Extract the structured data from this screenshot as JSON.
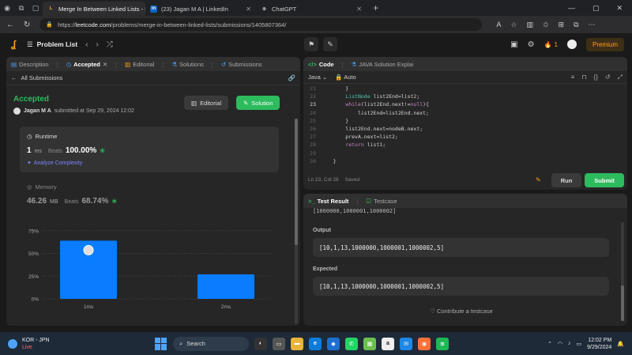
{
  "browser": {
    "tabs": [
      {
        "title": "Merge In Between Linked Lists - L",
        "active": true,
        "fav": "L",
        "favColor": "#ffa116"
      },
      {
        "title": "(23) Jagan M A | LinkedIn",
        "active": false,
        "fav": "in",
        "favColor": "#0a66c2"
      },
      {
        "title": "ChatGPT",
        "active": false,
        "fav": "⊛",
        "favColor": "#333333"
      }
    ],
    "new_tab": "+",
    "url_prefix": "https://",
    "url_host": "leetcode.com",
    "url_path": "/problems/merge-in-between-linked-lists/submissions/1405807364/"
  },
  "lcnav": {
    "problem_list": "Problem List",
    "streak": "1",
    "premium": "Premium"
  },
  "left": {
    "tabs": {
      "description": "Description",
      "accepted": "Accepted",
      "editorial": "Editorial",
      "solutions": "Solutions",
      "submissions": "Submissions"
    },
    "all_submissions": "All Submissions",
    "status": "Accepted",
    "user": "Jagan M A",
    "submitted": "submitted at Sep 29, 2024 12:02",
    "editorial_btn": "Editorial",
    "solution_btn": "Solution",
    "runtime": {
      "title": "Runtime",
      "value": "1",
      "unit": "ms",
      "beats_label": "Beats",
      "beats": "100.00%",
      "analyze": "Analyze Complexity"
    },
    "memory": {
      "title": "Memory",
      "value": "46.26",
      "unit": "MB",
      "beats_label": "Beats",
      "beats": "68.74%"
    }
  },
  "chart_data": {
    "type": "bar",
    "categories": [
      "1ms",
      "2ms"
    ],
    "values": [
      64,
      27
    ],
    "y_ticks": [
      "0%",
      "25%",
      "50%",
      "75%"
    ],
    "ylim": [
      0,
      80
    ],
    "bar_color": "#0a7cff",
    "grid": true
  },
  "editor": {
    "tabs": {
      "code": "Code",
      "solution": "JAVA Solution Explai"
    },
    "language": "Java",
    "mode": "Auto",
    "lines": [
      {
        "n": "21",
        "text": "        }"
      },
      {
        "n": "22",
        "text": "        ListNode list2End=list2;"
      },
      {
        "n": "23",
        "text": "        while(list2End.next!=null){"
      },
      {
        "n": "24",
        "text": "            list2End=list2End.next;"
      },
      {
        "n": "25",
        "text": "        }"
      },
      {
        "n": "26",
        "text": "        list2End.next=nodeB.next;"
      },
      {
        "n": "27",
        "text": "        prevA.next=list2;"
      },
      {
        "n": "28",
        "text": "        return list1;"
      },
      {
        "n": "29",
        "text": ""
      },
      {
        "n": "30",
        "text": "    }"
      }
    ],
    "cursor": "Ln 23, Col 28",
    "saved": "Saved",
    "run": "Run",
    "submit": "Submit"
  },
  "result": {
    "tabs": {
      "test_result": "Test Result",
      "testcase": "Testcase"
    },
    "clipped": "[1000000,1000001,1000002]",
    "output_label": "Output",
    "output": "[10,1,13,1000000,1000001,1000002,5]",
    "expected_label": "Expected",
    "expected": "[10,1,13,1000000,1000001,1000002,5]",
    "contribute": "Contribute a testcase"
  },
  "taskbar": {
    "weather_line1": "KOR - JPN",
    "weather_line2": "Live",
    "search": "Search",
    "time": "12:02 PM",
    "date": "9/29/2024"
  }
}
